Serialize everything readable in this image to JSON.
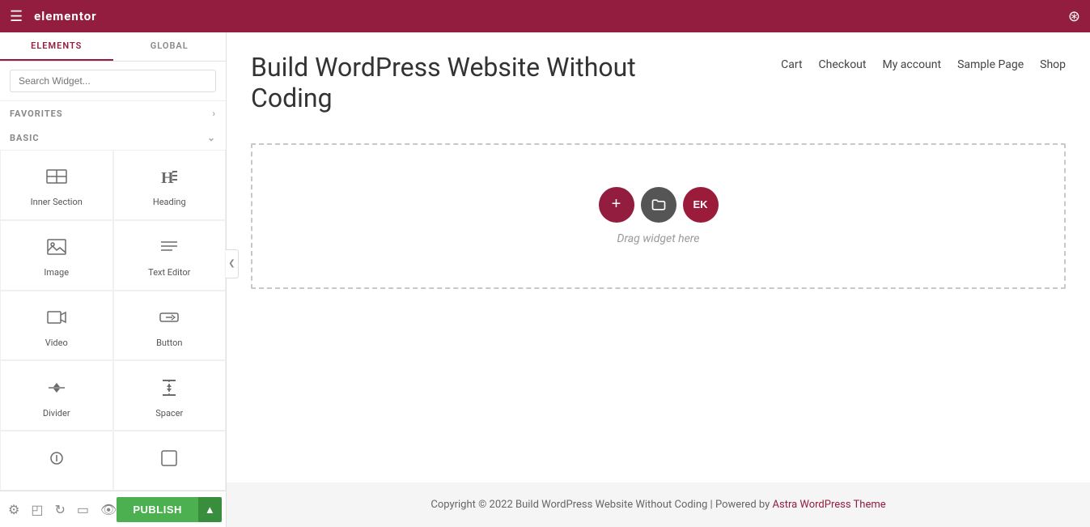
{
  "topbar": {
    "logo": "elementor",
    "hamburger": "☰",
    "grid": "⊞"
  },
  "sidebar": {
    "tab_elements": "Elements",
    "tab_global": "Global",
    "search_placeholder": "Search Widget...",
    "section_favorites": "Favorites",
    "section_basic": "Basic",
    "widgets": [
      {
        "id": "inner-section",
        "label": "Inner Section",
        "icon": "inner-section-icon"
      },
      {
        "id": "heading",
        "label": "Heading",
        "icon": "heading-icon"
      },
      {
        "id": "image",
        "label": "Image",
        "icon": "image-icon"
      },
      {
        "id": "text-editor",
        "label": "Text Editor",
        "icon": "text-editor-icon"
      },
      {
        "id": "video",
        "label": "Video",
        "icon": "video-icon"
      },
      {
        "id": "button",
        "label": "Button",
        "icon": "button-icon"
      },
      {
        "id": "divider",
        "label": "Divider",
        "icon": "divider-icon"
      },
      {
        "id": "spacer",
        "label": "Spacer",
        "icon": "spacer-icon"
      },
      {
        "id": "widget9",
        "label": "",
        "icon": ""
      },
      {
        "id": "widget10",
        "label": "",
        "icon": ""
      }
    ]
  },
  "bottombar": {
    "publish_label": "PUBLISH",
    "arrow": "▲"
  },
  "canvas": {
    "nav": {
      "cart": "Cart",
      "checkout": "Checkout",
      "my_account": "My account",
      "sample_page": "Sample Page",
      "shop": "Shop"
    },
    "page_title": "Build WordPress Website Without Coding",
    "drop_zone_hint": "Drag widget here",
    "footer_text": "Copyright © 2022 Build WordPress Website Without Coding | Powered by ",
    "footer_link_text": "Astra WordPress Theme"
  }
}
